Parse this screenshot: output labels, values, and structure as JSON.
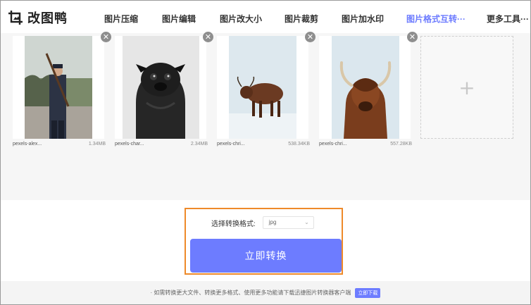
{
  "app": {
    "logo_text": "改图鸭",
    "logo_icon": "image-crop-icon"
  },
  "nav": {
    "items": [
      {
        "label": "图片压缩"
      },
      {
        "label": "图片编辑"
      },
      {
        "label": "图片改大小"
      },
      {
        "label": "图片裁剪"
      },
      {
        "label": "图片加水印"
      },
      {
        "label": "图片格式互转···"
      },
      {
        "label": "更多工具···"
      }
    ],
    "active_index": 5,
    "active_color": "#6c7bff"
  },
  "files": [
    {
      "name": "pexels-alex...",
      "size": "1.34MB",
      "image": "soldier-in-uniform-photo"
    },
    {
      "name": "pexels-char...",
      "size": "2.34MB",
      "image": "pug-dog-photo"
    },
    {
      "name": "pexels-chri...",
      "size": "538.34KB",
      "image": "highland-cow-in-snow-photo"
    },
    {
      "name": "pexels-chri...",
      "size": "557.28KB",
      "image": "highland-cow-closeup-photo"
    }
  ],
  "remove_icon": "close-icon",
  "add_icon": "plus-icon",
  "convert": {
    "label": "选择转换格式:",
    "selected_format": "jpg",
    "button_label": "立即转换",
    "accent": "#6d7cff",
    "highlight_border": "#ee8a2a"
  },
  "footer": {
    "text": "· 如需转换更大文件、转换更多格式、使用更多功能请下载迅捷图片转换器客户端",
    "button_label": "立即下载"
  }
}
